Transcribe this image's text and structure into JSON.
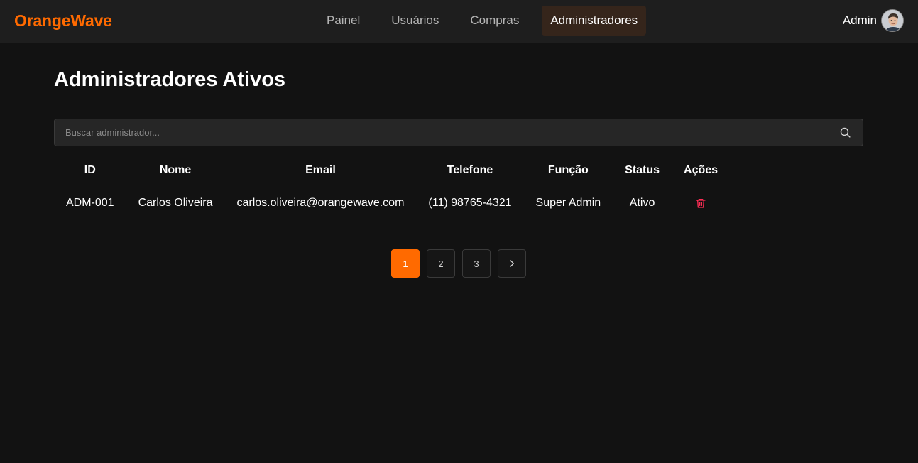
{
  "brand": {
    "name": "OrangeWave",
    "color": "#ff6a00"
  },
  "nav": {
    "items": [
      {
        "label": "Painel"
      },
      {
        "label": "Usuários"
      },
      {
        "label": "Compras"
      },
      {
        "label": "Administradores",
        "active": true
      }
    ]
  },
  "user": {
    "name": "Admin",
    "avatar_icon": "user-avatar"
  },
  "page": {
    "title": "Administradores Ativos"
  },
  "search": {
    "placeholder": "Buscar administrador...",
    "value": "",
    "icon": "search-icon"
  },
  "table": {
    "headers": [
      "ID",
      "Nome",
      "Email",
      "Telefone",
      "Função",
      "Status",
      "Ações"
    ],
    "rows": [
      {
        "id": "ADM-001",
        "name": "Carlos Oliveira",
        "email": "carlos.oliveira@orangewave.com",
        "phone": "(11) 98765-4321",
        "role": "Super Admin",
        "status": "Ativo",
        "action_icon": "trash-icon"
      }
    ]
  },
  "pagination": {
    "pages": [
      "1",
      "2",
      "3"
    ],
    "current": "1",
    "next_icon": "chevron-right-icon"
  },
  "colors": {
    "accent": "#ff6a00",
    "background": "#121212",
    "topbar": "#1e1e1e",
    "danger": "#ff2d55"
  }
}
